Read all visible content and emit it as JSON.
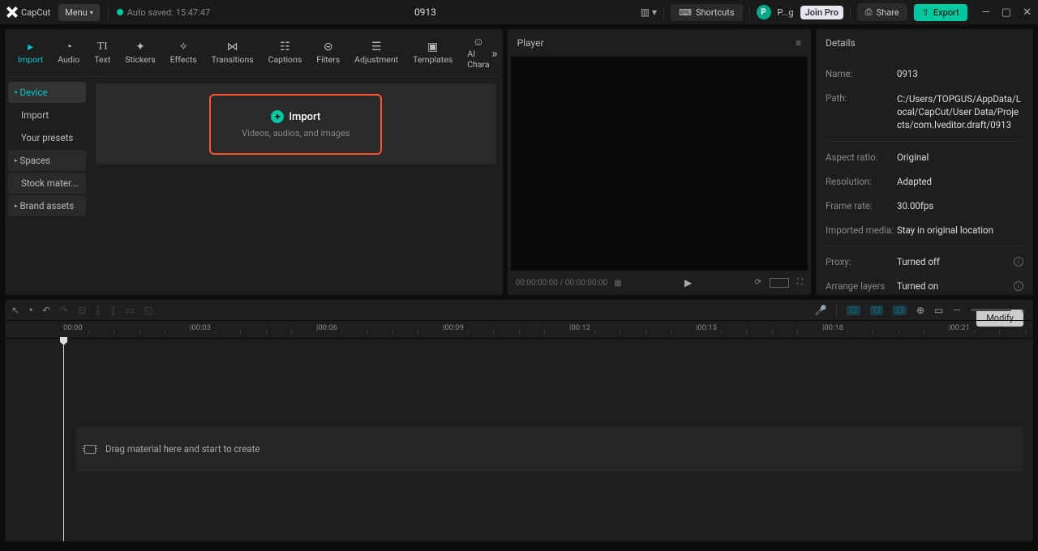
{
  "titlebar": {
    "brand": "CapCut",
    "menu": "Menu",
    "autosave": "Auto saved: 15:47:47",
    "project_title": "0913",
    "shortcuts": "Shortcuts",
    "user_initial": "P",
    "user_short": "P...g",
    "join_pro": "Join Pro",
    "share": "Share",
    "export": "Export"
  },
  "tabs": {
    "import": "Import",
    "audio": "Audio",
    "text": "Text",
    "stickers": "Stickers",
    "effects": "Effects",
    "transitions": "Transitions",
    "captions": "Captions",
    "filters": "Filters",
    "adjustment": "Adjustment",
    "templates": "Templates",
    "ai": "AI Chara"
  },
  "sidebar": {
    "device": "Device",
    "import": "Import",
    "presets": "Your presets",
    "spaces": "Spaces",
    "stock": "Stock mater...",
    "brand": "Brand assets"
  },
  "import_box": {
    "title": "Import",
    "subtitle": "Videos, audios, and images"
  },
  "player": {
    "title": "Player",
    "time": "00:00:00:00 / 00:00:00:00"
  },
  "details": {
    "title": "Details",
    "rows": {
      "name": {
        "label": "Name:",
        "value": "0913"
      },
      "path": {
        "label": "Path:",
        "value": "C:/Users/TOPGUS/AppData/Local/CapCut/User Data/Projects/com.lveditor.draft/0913"
      },
      "aspect": {
        "label": "Aspect ratio:",
        "value": "Original"
      },
      "resolution": {
        "label": "Resolution:",
        "value": "Adapted"
      },
      "framerate": {
        "label": "Frame rate:",
        "value": "30.00fps"
      },
      "imported": {
        "label": "Imported media:",
        "value": "Stay in original location"
      },
      "proxy": {
        "label": "Proxy:",
        "value": "Turned off"
      },
      "arrange": {
        "label": "Arrange layers",
        "value": "Turned on"
      }
    },
    "modify": "Modify"
  },
  "timeline": {
    "marks": [
      "00:00",
      "|00:03",
      "|00:06",
      "|00:09",
      "|00:12",
      "|00:15",
      "|00:18",
      "|00:21"
    ],
    "drop_hint": "Drag material here and start to create"
  }
}
